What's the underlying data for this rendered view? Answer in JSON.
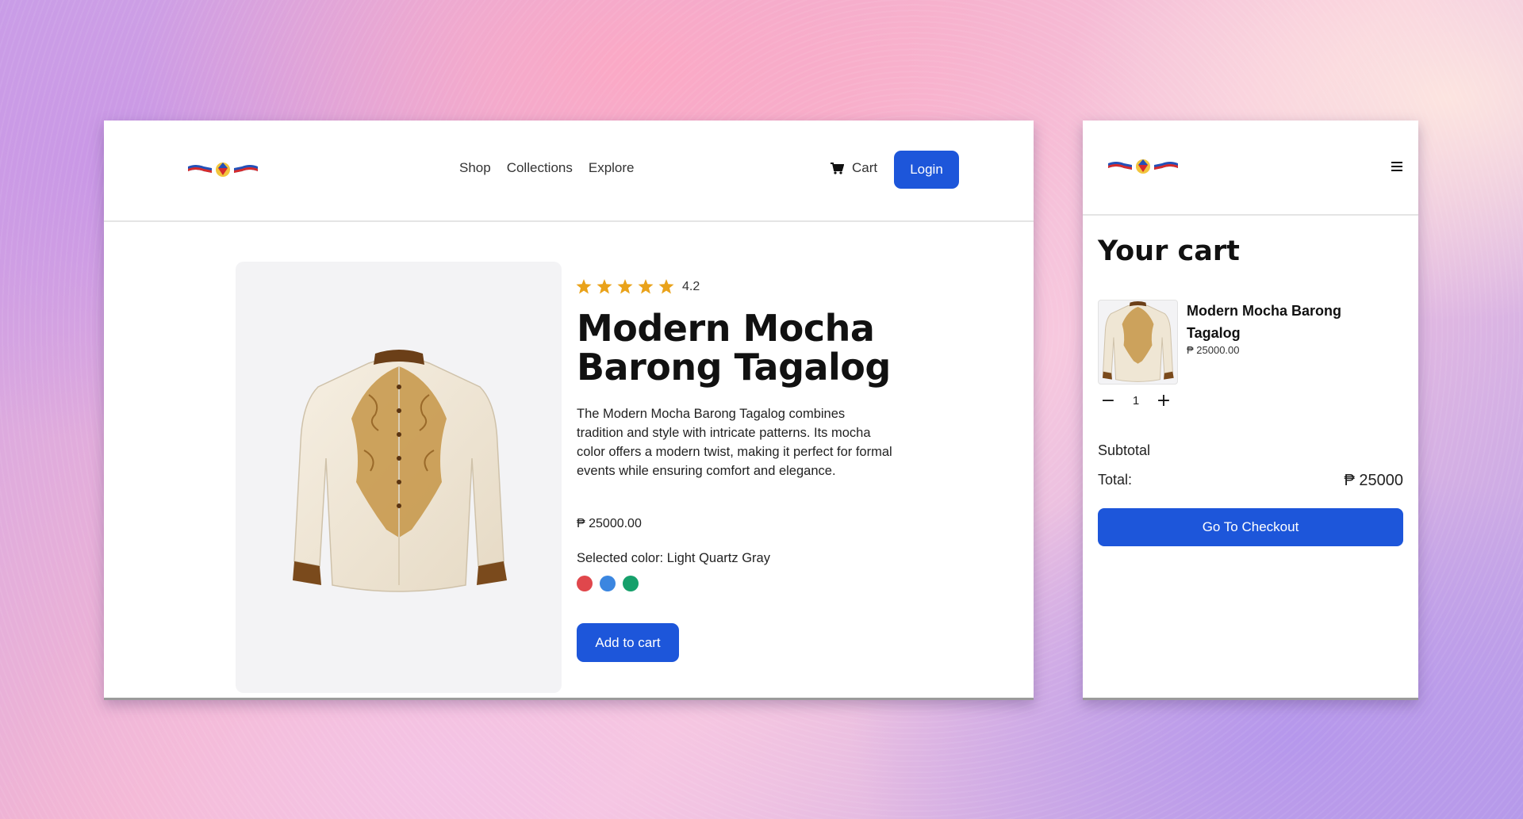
{
  "desktop": {
    "nav": {
      "links": [
        "Shop",
        "Collections",
        "Explore"
      ],
      "cart_label": "Cart",
      "login_label": "Login"
    },
    "product": {
      "rating": "4.2",
      "stars": 5,
      "title": "Modern Mocha Barong Tagalog",
      "description": "The Modern Mocha Barong Tagalog combines tradition and style with intricate patterns. Its mocha color offers a modern twist, making it perfect for formal events while ensuring comfort and elegance.",
      "price": "₱ 25000.00",
      "selected_color_label": "Selected color: Light Quartz Gray",
      "colors": [
        "#e0474c",
        "#3b86e0",
        "#16a06b"
      ],
      "add_to_cart_label": "Add to cart"
    }
  },
  "mobile": {
    "cart_title": "Your cart",
    "item": {
      "name": "Modern Mocha Barong Tagalog",
      "price": "₱ 25000.00",
      "quantity": "1"
    },
    "subtotal_label": "Subtotal",
    "total_label": "Total:",
    "total_value": "₱ 25000",
    "checkout_label": "Go To Checkout"
  },
  "theme": {
    "accent": "#1d56da",
    "star_color": "#e9a21a"
  }
}
